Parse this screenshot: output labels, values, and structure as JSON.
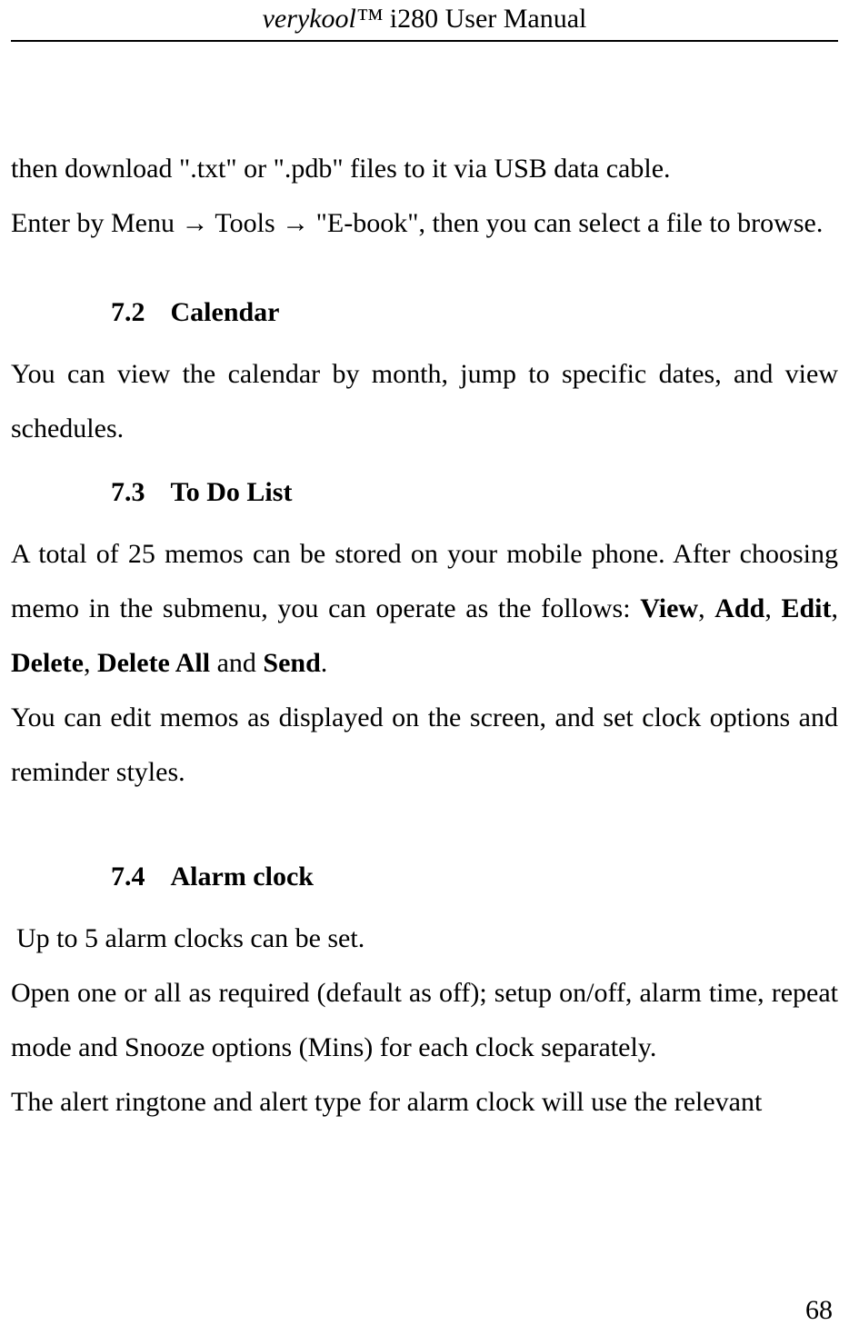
{
  "header": {
    "brand_italic": "verykool™",
    "title_rest": " i280 User Manual"
  },
  "body": {
    "p1": "then download \".txt\" or \".pdb\" files to it via USB data cable.",
    "p2_a": "Enter by Menu ",
    "p2_arrow1": "→",
    "p2_b": " Tools ",
    "p2_arrow2": "→",
    "p2_c": " \"E-book\", then you can select a file to browse.",
    "s72_num": "7.2",
    "s72_title": "Calendar",
    "s72_p1": "You can view the calendar by month, jump to specific dates, and view schedules.",
    "s73_num": "7.3",
    "s73_title": "To Do List",
    "s73_p1_a": "A total of 25 memos can be stored on your mobile phone. After choosing memo in the submenu, you can operate as the follows: ",
    "s73_p1_view": "View",
    "s73_p1_c1": ", ",
    "s73_p1_add": "Add",
    "s73_p1_c2": ", ",
    "s73_p1_edit": "Edit",
    "s73_p1_c3": ", ",
    "s73_p1_delete": "Delete",
    "s73_p1_c4": ", ",
    "s73_p1_deleteall": "Delete All",
    "s73_p1_and": " and ",
    "s73_p1_send": "Send",
    "s73_p1_dot": ".",
    "s73_p2": "You can edit memos as displayed on the screen, and set clock options and reminder styles.",
    "s74_num": "7.4",
    "s74_title": "Alarm clock",
    "s74_p1": "Up to 5 alarm clocks can be set.",
    "s74_p2": "Open one or all as required (default as off); setup on/off, alarm time, repeat mode and Snooze options (Mins) for each clock separately.",
    "s74_p3": "The alert ringtone and alert type for alarm clock will use the relevant"
  },
  "page_number": "68"
}
